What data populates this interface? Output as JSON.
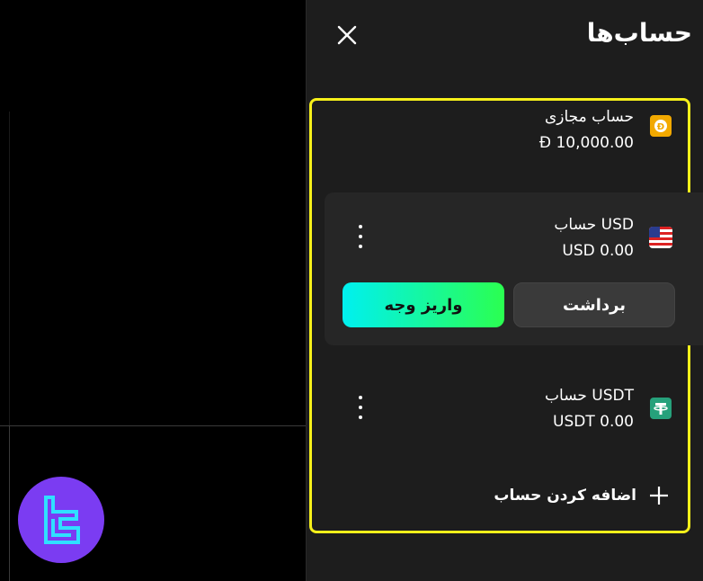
{
  "panel": {
    "title": "حساب‌ها",
    "accounts": [
      {
        "name": "حساب مجازی",
        "balance": "Đ 10,000.00",
        "icon": "demo-coin-icon"
      },
      {
        "name": "USD حساب",
        "balance": "USD 0.00",
        "icon": "us-flag-icon"
      },
      {
        "name": "USDT حساب",
        "balance": "USDT 0.00",
        "icon": "tether-icon"
      }
    ],
    "withdraw_label": "برداشت",
    "deposit_label": "واریز وجه",
    "add_account_label": "اضافه کردن حساب"
  },
  "colors": {
    "highlight": "#f6f01a",
    "deposit_gradient_start": "#00f0f0",
    "deposit_gradient_end": "#2bff50",
    "demo_coin": "#f2a900",
    "tether": "#26a17b",
    "logo": "#7b3cf2"
  }
}
